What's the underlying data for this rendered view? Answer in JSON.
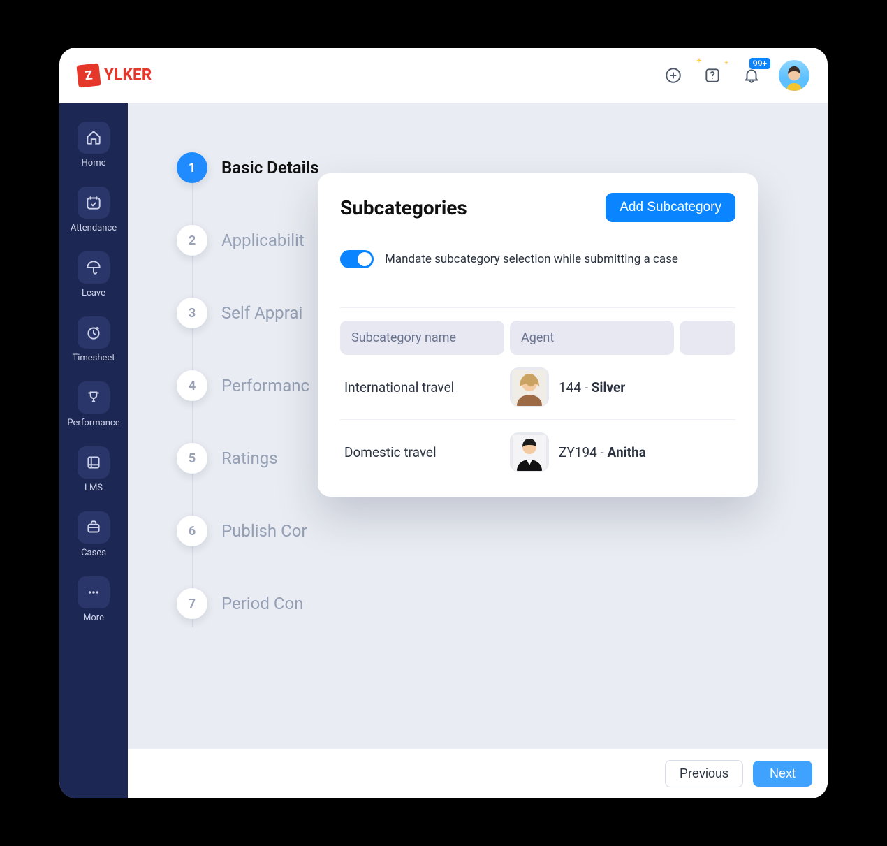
{
  "brand": {
    "tile": "Z",
    "name": "YLKER"
  },
  "topbar": {
    "notification_badge": "99+"
  },
  "sidebar": {
    "items": [
      {
        "label": "Home",
        "icon": "home-icon"
      },
      {
        "label": "Attendance",
        "icon": "calendar-check-icon"
      },
      {
        "label": "Leave",
        "icon": "umbrella-icon"
      },
      {
        "label": "Timesheet",
        "icon": "clock-icon"
      },
      {
        "label": "Performance",
        "icon": "trophy-icon"
      },
      {
        "label": "LMS",
        "icon": "book-icon"
      },
      {
        "label": "Cases",
        "icon": "briefcase-icon"
      },
      {
        "label": "More",
        "icon": "more-icon"
      }
    ]
  },
  "stepper": {
    "steps": [
      {
        "num": "1",
        "label": "Basic Details",
        "active": true
      },
      {
        "num": "2",
        "label": "Applicabilit"
      },
      {
        "num": "3",
        "label": "Self Apprai"
      },
      {
        "num": "4",
        "label": "Performanc"
      },
      {
        "num": "5",
        "label": "Ratings"
      },
      {
        "num": "6",
        "label": "Publish Cor"
      },
      {
        "num": "7",
        "label": "Period Con"
      }
    ]
  },
  "card": {
    "title": "Subcategories",
    "add_button": "Add Subcategory",
    "toggle_on": true,
    "toggle_label": "Mandate subcategory selection while submitting a case",
    "columns": {
      "name": "Subcategory name",
      "agent": "Agent"
    },
    "rows": [
      {
        "name": "International travel",
        "agent_id": "144",
        "agent_name": "Silver"
      },
      {
        "name": "Domestic travel",
        "agent_id": "ZY194",
        "agent_name": "Anitha"
      }
    ]
  },
  "footer": {
    "prev": "Previous",
    "next": "Next"
  }
}
